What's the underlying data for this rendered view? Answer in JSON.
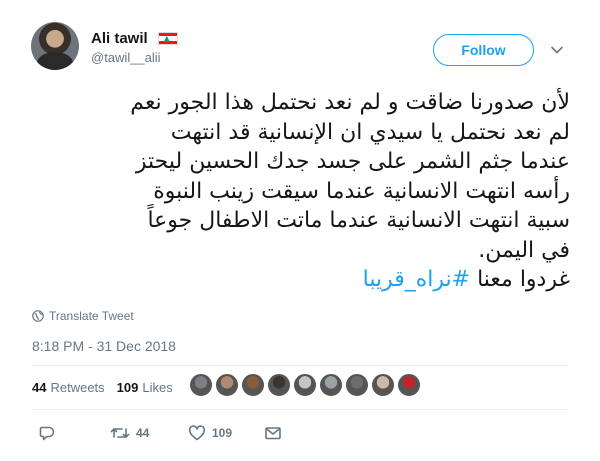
{
  "user": {
    "display_name": "Ali tawil",
    "username": "@tawil__alii",
    "flag": "lebanon-flag"
  },
  "follow_label": "Follow",
  "tweet": {
    "lines": [
      "لأن صدورنا ضاقت و لم نعد نحتمل هذا الجور نعم",
      "لم نعد نحتمل يا سيدي ان الإنسانية قد انتهت",
      "عندما جثم الشمر على جسد جدك الحسين ليحتز",
      "رأسه انتهت الانسانية عندما سيقت زينب النبوة",
      "سبية انتهت الانسانية عندما ماتت الاطفال جوعاً",
      "في اليمن."
    ],
    "last_line_prefix": "غردوا معنا ",
    "hashtag": "#نراه_قريبا"
  },
  "translate_label": "Translate Tweet",
  "timestamp": "8:18 PM - 31 Dec 2018",
  "stats": {
    "retweets_count": "44",
    "retweets_label": "Retweets",
    "likes_count": "109",
    "likes_label": "Likes"
  },
  "liker_faces": [
    "#7d7f86",
    "#b08b74",
    "#8a5a3c",
    "#3b3430",
    "#c8c4be",
    "#9aa2a6",
    "#6a6e70",
    "#d0b8a4",
    "#c0252a"
  ],
  "actions": {
    "reply_count": "",
    "retweet_count": "44",
    "like_count": "109"
  },
  "colors": {
    "accent": "#1da1f2",
    "muted": "#657786",
    "text": "#14171a"
  }
}
